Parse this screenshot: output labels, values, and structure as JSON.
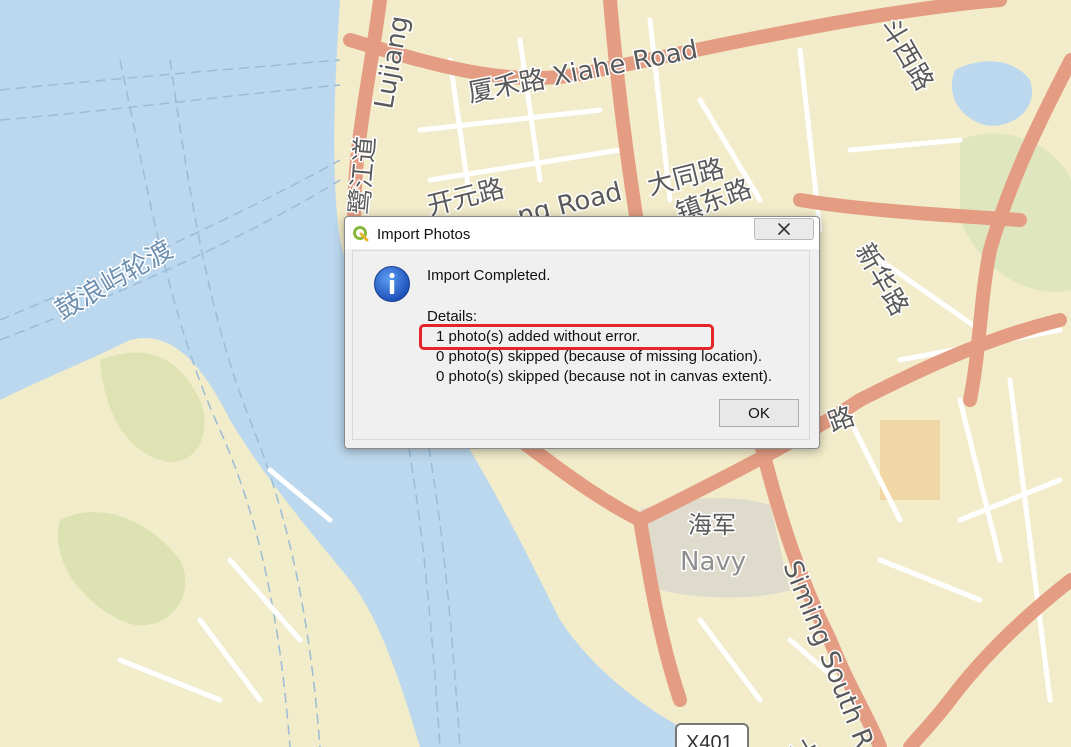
{
  "map": {
    "labels": {
      "road_xiahe": "厦禾路 Xiahe Road",
      "road_lujiang": "Lujiang",
      "road_lujiang_cn": "鹭江道",
      "road_datong": "大同路",
      "road_kaiyuan": "开元路",
      "road_zhongshan": "ng Road",
      "road_dongfang": "镇东路",
      "road_doucheng": "斗西路",
      "road_xinhua": "新华路",
      "road_siming_cn": "路",
      "navy_cn": "海军",
      "navy_en": "Navy",
      "siming_south": "Siming South R",
      "ferry": "鼓浪屿轮渡",
      "route_shield": "X401",
      "corner_cn": "大"
    }
  },
  "dialog": {
    "title": "Import Photos",
    "message": "Import Completed.",
    "details_heading": "Details:",
    "details": [
      "1 photo(s) added without error.",
      "0 photo(s) skipped (because of missing location).",
      "0 photo(s) skipped (because not in canvas extent)."
    ],
    "ok_label": "OK"
  }
}
